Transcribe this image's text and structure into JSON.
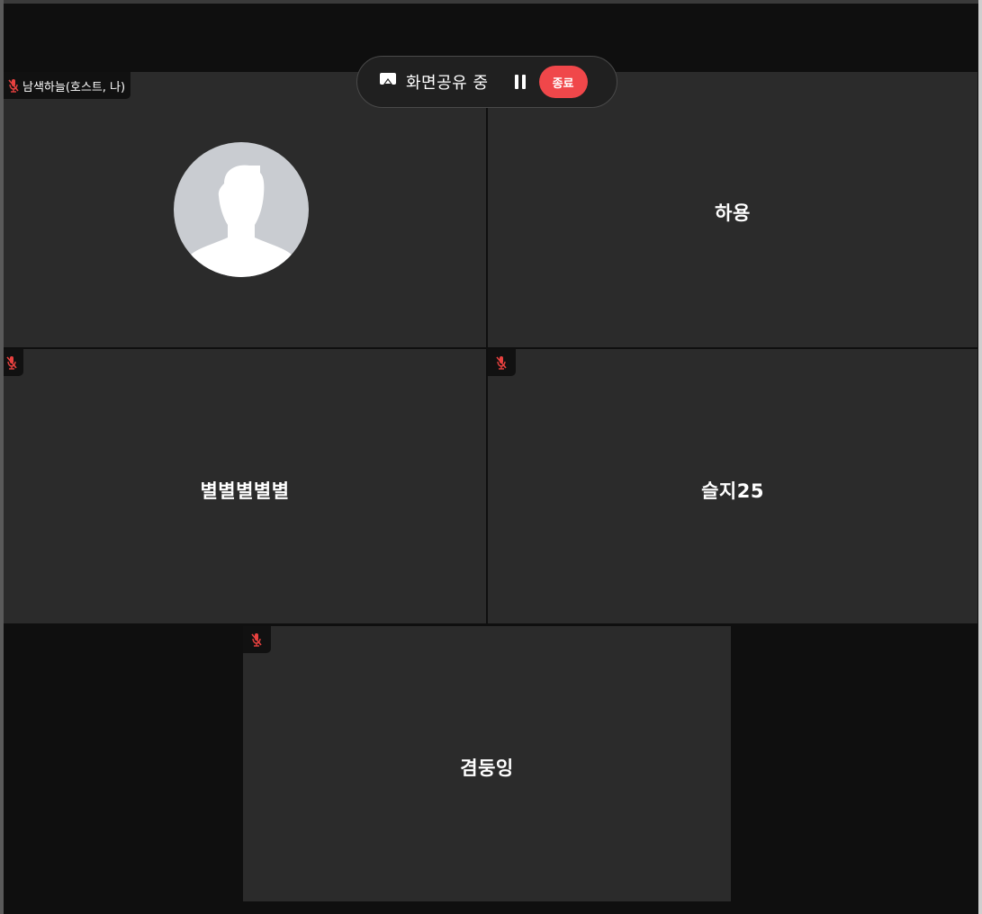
{
  "share_bar": {
    "status_label": "화면공유 중",
    "end_label": "종료"
  },
  "participants": [
    {
      "name": "남색하늘(호스트, 나)",
      "muted": true,
      "video": "avatar"
    },
    {
      "name": "하용",
      "muted": false
    },
    {
      "name": "별별별별별",
      "muted": true
    },
    {
      "name": "슬지25",
      "muted": true
    },
    {
      "name": "겸둥잉",
      "muted": true
    }
  ],
  "colors": {
    "background": "#0f0f0f",
    "tile": "#2b2b2b",
    "muted_icon": "#e8413f",
    "end_button": "#f0474a"
  }
}
